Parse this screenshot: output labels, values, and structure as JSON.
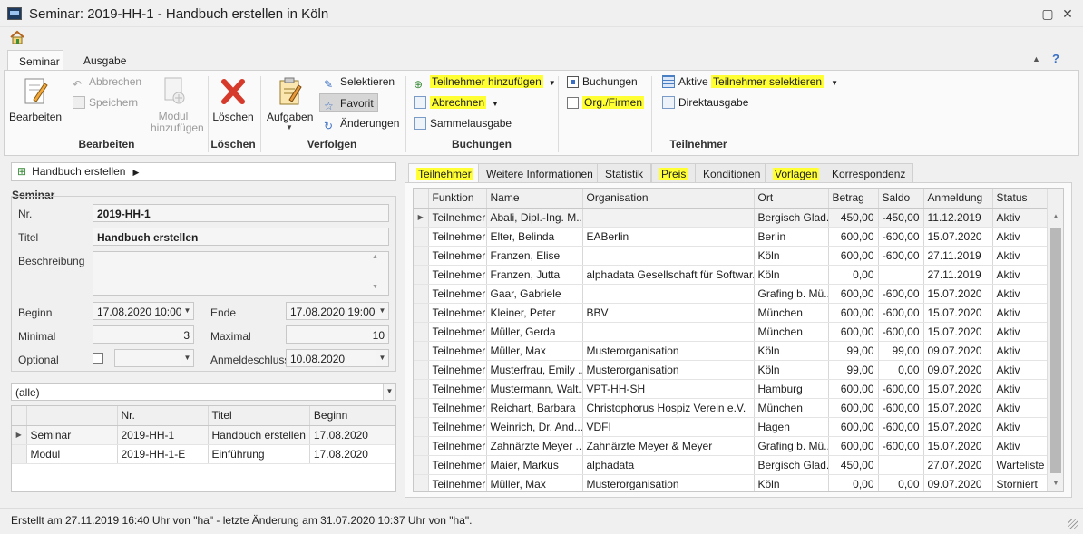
{
  "window": {
    "title": "Seminar: 2019-HH-1 - Handbuch erstellen in Köln",
    "minimize": "–",
    "maximize": "▢",
    "close": "✕"
  },
  "ribbon": {
    "tabs": [
      "Seminar",
      "Ausgabe"
    ],
    "groups": {
      "bearbeiten": {
        "label": "Bearbeiten",
        "edit": "Bearbeiten",
        "cancel": "Abbrechen",
        "save": "Speichern",
        "add_module": "Modul hinzufügen"
      },
      "loeschen": {
        "label": "Löschen",
        "delete": "Löschen"
      },
      "verfolgen": {
        "label": "Verfolgen",
        "tasks": "Aufgaben",
        "select": "Selektieren",
        "favorite": "Favorit",
        "changes": "Änderungen"
      },
      "buchungen": {
        "label": "Buchungen",
        "add_participant": "Teilnehmer hinzufügen",
        "billing": "Abrechnen",
        "bulk_output": "Sammelausgabe"
      },
      "buchungen_toggle": {
        "bookings": "Buchungen",
        "orgs": "Org./Firmen"
      },
      "teilnehmer": {
        "label": "Teilnehmer",
        "select_active_prefix": "Aktive ",
        "select_active_hl": "Teilnehmer selektieren",
        "direct_output": "Direktausgabe"
      }
    }
  },
  "left": {
    "breadcrumb": "Handbuch erstellen",
    "section_title": "Seminar",
    "fields": {
      "nr_label": "Nr.",
      "nr_value": "2019-HH-1",
      "titel_label": "Titel",
      "titel_value": "Handbuch erstellen",
      "beschreibung_label": "Beschreibung",
      "beschreibung_value": "",
      "beginn_label": "Beginn",
      "beginn_value": "17.08.2020 10:00",
      "ende_label": "Ende",
      "ende_value": "17.08.2020 19:00",
      "minimal_label": "Minimal",
      "minimal_value": "3",
      "maximal_label": "Maximal",
      "maximal_value": "10",
      "optional_label": "Optional",
      "optional_value": "",
      "anmeldeschluss_label": "Anmeldeschluss",
      "anmeldeschluss_value": "10.08.2020"
    },
    "filter_value": "(alle)",
    "modules_table": {
      "columns": [
        "",
        "Nr.",
        "Titel",
        "Beginn"
      ],
      "rows": [
        [
          "Seminar",
          "2019-HH-1",
          "Handbuch erstellen",
          "17.08.2020"
        ],
        [
          "Modul",
          "2019-HH-1-E",
          "Einführung",
          "17.08.2020"
        ]
      ]
    }
  },
  "right": {
    "tabs": [
      "Teilnehmer",
      "Weitere Informationen",
      "Statistik",
      "Preis",
      "Konditionen",
      "Vorlagen",
      "Korrespondenz"
    ],
    "table": {
      "columns": [
        "Funktion",
        "Name",
        "Organisation",
        "Ort",
        "Betrag",
        "Saldo",
        "Anmeldung",
        "Status"
      ],
      "rows": [
        [
          "Teilnehmer",
          "Abali, Dipl.-Ing. M...",
          "",
          "Bergisch Glad...",
          "450,00",
          "-450,00",
          "11.12.2019",
          "Aktiv"
        ],
        [
          "Teilnehmer",
          "Elter, Belinda",
          "EABerlin",
          "Berlin",
          "600,00",
          "-600,00",
          "15.07.2020",
          "Aktiv"
        ],
        [
          "Teilnehmer",
          "Franzen, Elise",
          "",
          "Köln",
          "600,00",
          "-600,00",
          "27.11.2019",
          "Aktiv"
        ],
        [
          "Teilnehmer",
          "Franzen, Jutta",
          "alphadata Gesellschaft für Softwar...",
          "Köln",
          "0,00",
          "",
          "27.11.2019",
          "Aktiv"
        ],
        [
          "Teilnehmer",
          "Gaar, Gabriele",
          "",
          "Grafing b. Mü...",
          "600,00",
          "-600,00",
          "15.07.2020",
          "Aktiv"
        ],
        [
          "Teilnehmer",
          "Kleiner, Peter",
          "BBV",
          "München",
          "600,00",
          "-600,00",
          "15.07.2020",
          "Aktiv"
        ],
        [
          "Teilnehmer",
          "Müller, Gerda",
          "",
          "München",
          "600,00",
          "-600,00",
          "15.07.2020",
          "Aktiv"
        ],
        [
          "Teilnehmer",
          "Müller, Max",
          "Musterorganisation",
          "Köln",
          "99,00",
          "99,00",
          "09.07.2020",
          "Aktiv"
        ],
        [
          "Teilnehmer",
          "Musterfrau, Emily ...",
          "Musterorganisation",
          "Köln",
          "99,00",
          "0,00",
          "09.07.2020",
          "Aktiv"
        ],
        [
          "Teilnehmer",
          "Mustermann, Walt...",
          "VPT-HH-SH",
          "Hamburg",
          "600,00",
          "-600,00",
          "15.07.2020",
          "Aktiv"
        ],
        [
          "Teilnehmer",
          "Reichart, Barbara",
          "Christophorus Hospiz Verein e.V.",
          "München",
          "600,00",
          "-600,00",
          "15.07.2020",
          "Aktiv"
        ],
        [
          "Teilnehmer",
          "Weinrich, Dr. And...",
          "VDFI",
          "Hagen",
          "600,00",
          "-600,00",
          "15.07.2020",
          "Aktiv"
        ],
        [
          "Teilnehmer",
          "Zahnärzte Meyer ...",
          "Zahnärzte Meyer & Meyer",
          "Grafing b. Mü...",
          "600,00",
          "-600,00",
          "15.07.2020",
          "Aktiv"
        ],
        [
          "Teilnehmer",
          "Maier, Markus",
          "alphadata",
          "Bergisch Glad...",
          "450,00",
          "",
          "27.07.2020",
          "Warteliste"
        ],
        [
          "Teilnehmer",
          "Müller, Max",
          "Musterorganisation",
          "Köln",
          "0,00",
          "0,00",
          "09.07.2020",
          "Storniert"
        ]
      ]
    }
  },
  "status": {
    "text": "Erstellt am 27.11.2019 16:40 Uhr von \"ha\" - letzte Änderung am 31.07.2020 10:37 Uhr von \"ha\"."
  }
}
